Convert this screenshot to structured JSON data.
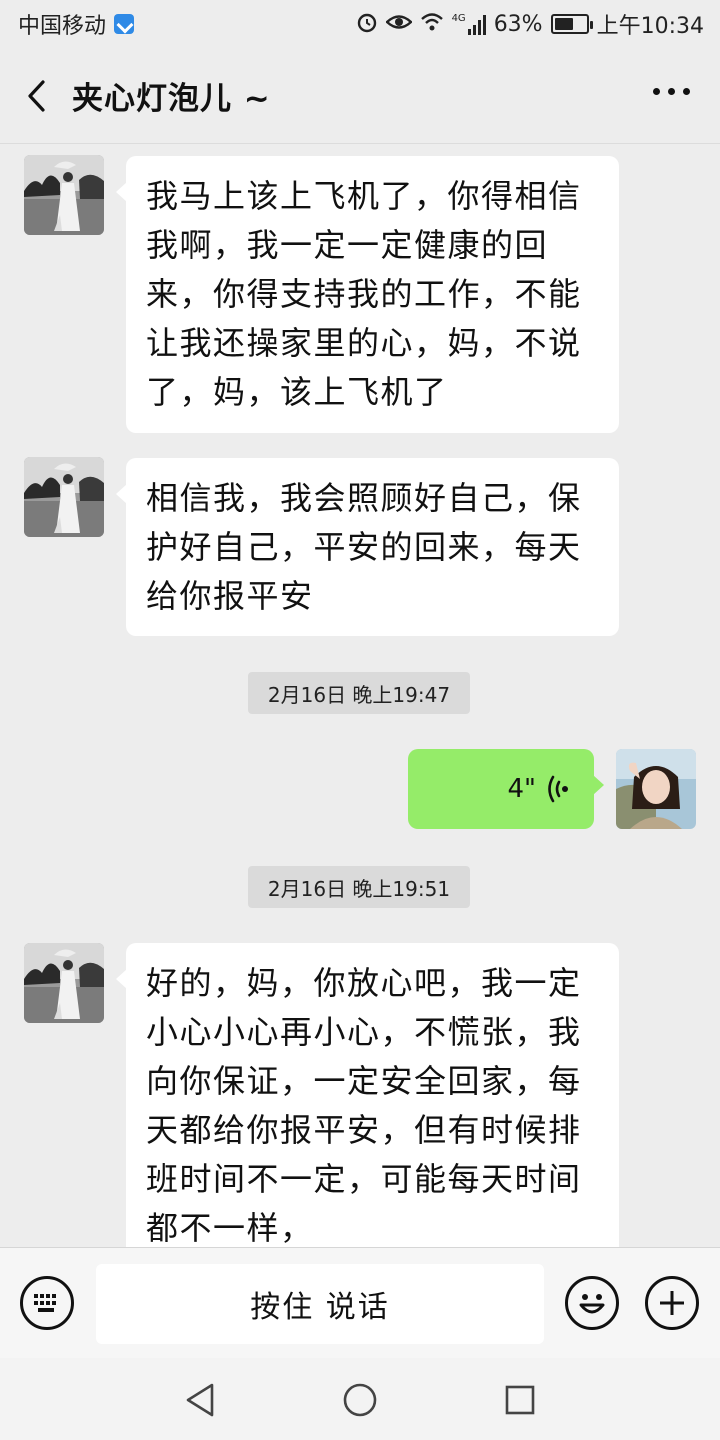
{
  "status_bar": {
    "carrier": "中国移动",
    "network": "4G",
    "battery": "63%",
    "battery_level": 0.63,
    "time": "上午10:34"
  },
  "header": {
    "title": "夹心灯泡儿 ~"
  },
  "messages": [
    {
      "side": "left",
      "type": "text",
      "text": "我马上该上飞机了，你得相信我啊，我一定一定健康的回来，你得支持我的工作，不能让我还操家里的心，妈，不说了，妈，该上飞机了"
    },
    {
      "side": "left",
      "type": "text",
      "text": "相信我，我会照顾好自己，保护好自己，平安的回来，每天给你报平安"
    },
    {
      "type": "time",
      "text": "2月16日 晚上19:47"
    },
    {
      "side": "right",
      "type": "voice",
      "duration": "4\""
    },
    {
      "type": "time",
      "text": "2月16日 晚上19:51"
    },
    {
      "side": "left",
      "type": "text",
      "text": "好的，妈，你放心吧，我一定小心小心再小心，不慌张，我向你保证，一定安全回家，每天都给你报平安，但有时候排班时间不一定，可能每天时间都不一样，"
    }
  ],
  "input_bar": {
    "hold_to_talk": "按住 说话"
  },
  "colors": {
    "chat_background": "#ededed",
    "outgoing_bubble": "#95ec69",
    "incoming_bubble": "#ffffff",
    "time_pill": "#dadada"
  }
}
